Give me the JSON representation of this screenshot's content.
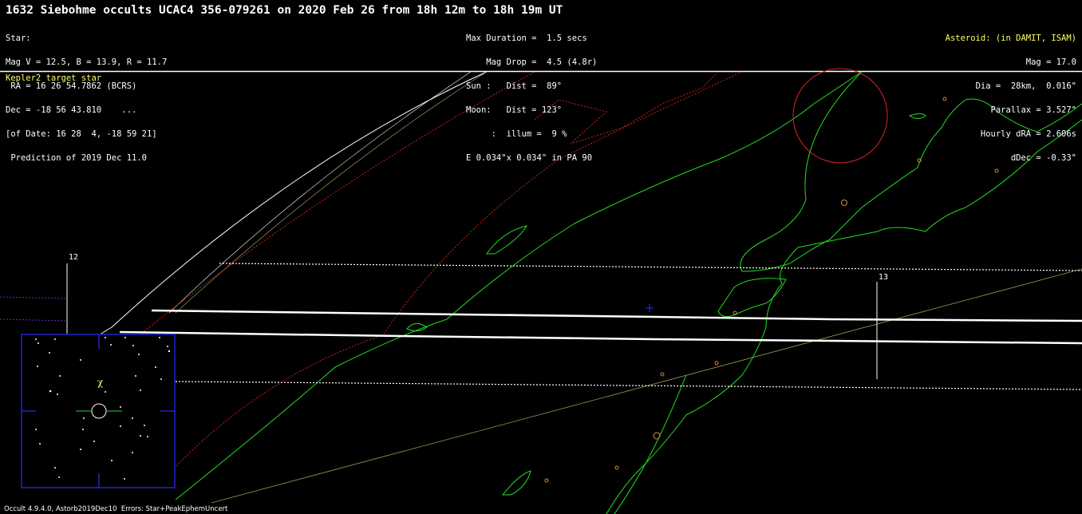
{
  "header": {
    "title": "1632 Siebohme occults UCAC4 356-079261 on 2020 Feb 26 from 18h 12m to 18h 19m UT",
    "star_lines": [
      "Star:",
      "Mag V = 12.5, B = 13.9, R = 11.7",
      " RA = 16 26 54.7862 (BCRS)",
      "Dec = -18 56 43.810    ...",
      "[of Date: 16 28  4, -18 59 21]",
      " Prediction of 2019 Dec 11.0"
    ],
    "event_lines": [
      "Max Duration =  1.5 secs",
      "    Mag Drop =  4.5 (4.8r)",
      "Sun :   Dist =  89°",
      "Moon:   Dist = 123°",
      "     :  illum =  9 %",
      "E 0.034\"x 0.034\" in PA 90"
    ],
    "asteroid_label": "Asteroid: (in DAMIT, ISAM)",
    "asteroid_lines": [
      "Mag = 17.0",
      "Dia =  28km,  0.016\"",
      "Parallax = 3.527\"",
      "Hourly dRA = 2.606s",
      "dDec = -0.33\""
    ]
  },
  "map": {
    "kepler_label": "Kepler2 target star",
    "time_markers": [
      "12",
      "13"
    ],
    "finder_star_label": "χ",
    "footer": "Occult 4.9.4.0, Astorb2019Dec10  Errors: Star+PeakEphemUncert"
  },
  "colors": {
    "background": "#000000",
    "text": "#ffffff",
    "highlight_text": "#ffff66",
    "coastline": "#22dd22",
    "path_center": "#ffffff",
    "sigma_limits": "#ffffff",
    "terminator": "#cc2222",
    "finder_frame": "#2222cc",
    "ground_track": "#999955",
    "city_marker": "#dd8833",
    "moon_circle": "#dd2222"
  }
}
